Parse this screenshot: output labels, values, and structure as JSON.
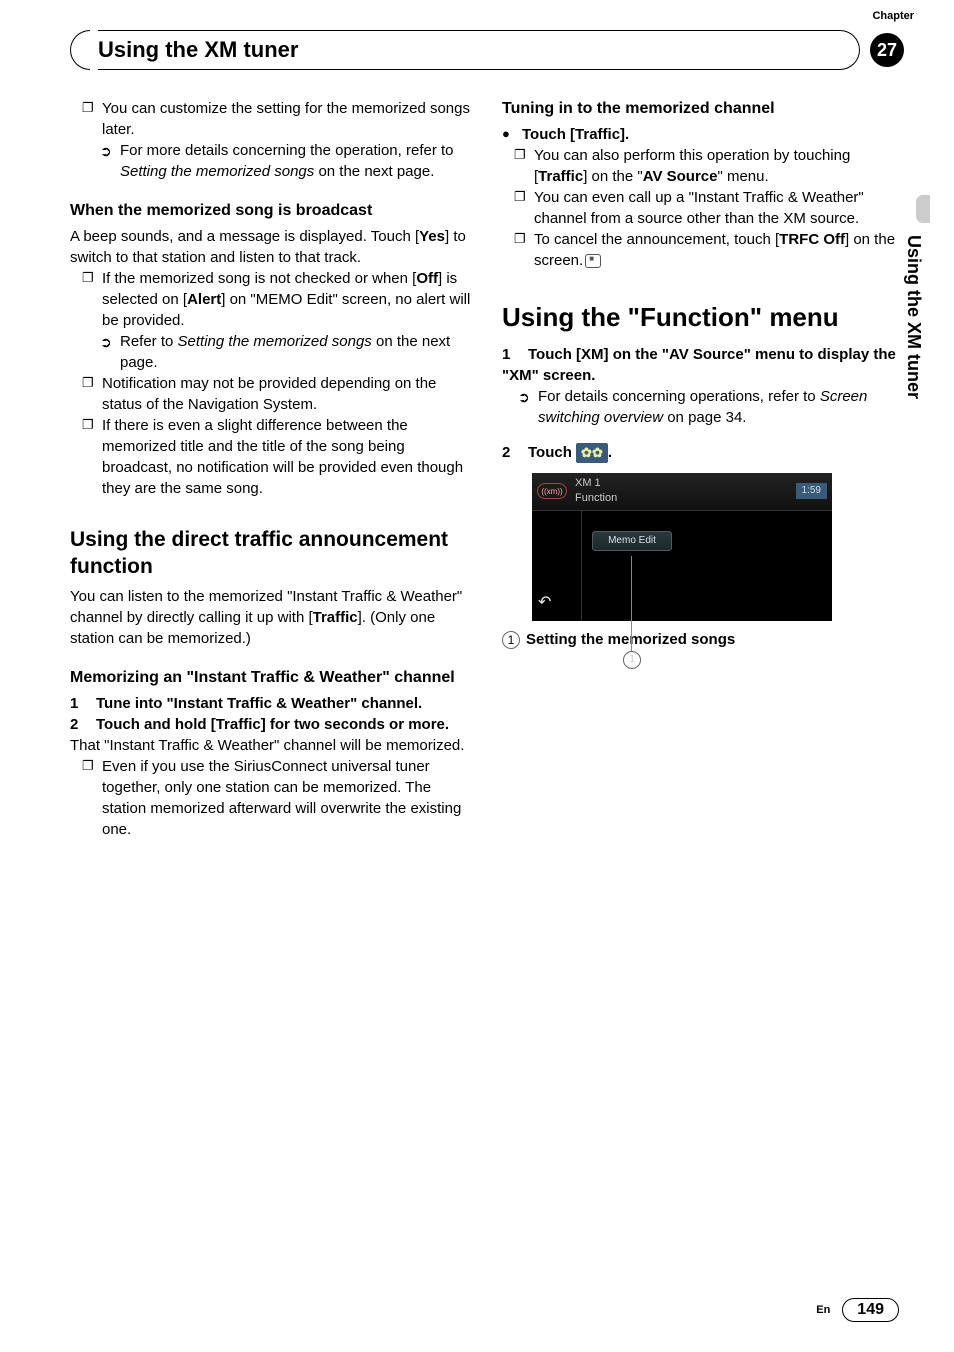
{
  "chapter": {
    "label": "Chapter",
    "number": "27",
    "title": "Using the XM tuner"
  },
  "side_text": "Using the XM tuner",
  "left": {
    "n1": "You can customize the setting for the memorized songs later.",
    "a1_pre": "For more details concerning the operation, refer to ",
    "a1_em": "Setting the memorized songs",
    "a1_post": " on the next page.",
    "h1": "When the memorized song is broadcast",
    "p1_a": "A beep sounds, and a message is displayed. Touch [",
    "p1_b": "Yes",
    "p1_c": "] to switch to that station and listen to that track.",
    "n2_a": "If the memorized song is not checked or when [",
    "n2_b": "Off",
    "n2_c": "] is selected on [",
    "n2_d": "Alert",
    "n2_e": "] on \"MEMO Edit\" screen, no alert will be provided.",
    "a2_pre": "Refer to ",
    "a2_em": "Setting the memorized songs",
    "a2_post": " on the next page.",
    "n3": "Notification may not be provided depending on the status of the Navigation System.",
    "n4": "If there is even a slight difference between the memorized title and the title of the song being broadcast, no notification will be provided even though they are the same song.",
    "h2": "Using the direct traffic announcement function",
    "p2_a": "You can listen to the memorized \"Instant Traffic & Weather\" channel by directly calling it up with [",
    "p2_b": "Traffic",
    "p2_c": "]. (Only one station can be memorized.)",
    "h3": "Memorizing an \"Instant Traffic & Weather\" channel",
    "s1": "Tune into \"Instant Traffic & Weather\" channel.",
    "s2": "Touch and hold [Traffic] for two seconds or more.",
    "p3": "That \"Instant Traffic & Weather\" channel will be memorized.",
    "n5": "Even if you use the SiriusConnect universal tuner together, only one station can be memorized. The station memorized afterward will overwrite the existing one."
  },
  "right": {
    "h1": "Tuning in to the memorized channel",
    "b1": "Touch [Traffic].",
    "n1_a": "You can also perform this operation by touching [",
    "n1_b": "Traffic",
    "n1_c": "] on the \"",
    "n1_d": "AV Source",
    "n1_e": "\" menu.",
    "n2": "You can even call up a \"Instant Traffic & Weather\" channel from a source other than the XM source.",
    "n3_a": "To cancel the announcement, touch [",
    "n3_b": "TRFC Off",
    "n3_c": "] on the screen.",
    "h2_a": "Using the \"",
    "h2_b": "Function",
    "h2_c": "\" menu",
    "s1": "Touch [XM] on the \"AV Source\" menu to display the \"XM\" screen.",
    "a1_pre": "For details concerning operations, refer to ",
    "a1_em": "Screen switching overview",
    "a1_post": " on page 34.",
    "s2": "Touch ",
    "icon": "✿✿",
    "ss": {
      "source": "XM 1",
      "menu": "Function",
      "tab": "Memo Edit",
      "time": "1:59",
      "logo": "((xm))"
    },
    "c1_num": "1",
    "c1_label": "Setting the memorized songs"
  },
  "footer": {
    "lang": "En",
    "page": "149"
  }
}
